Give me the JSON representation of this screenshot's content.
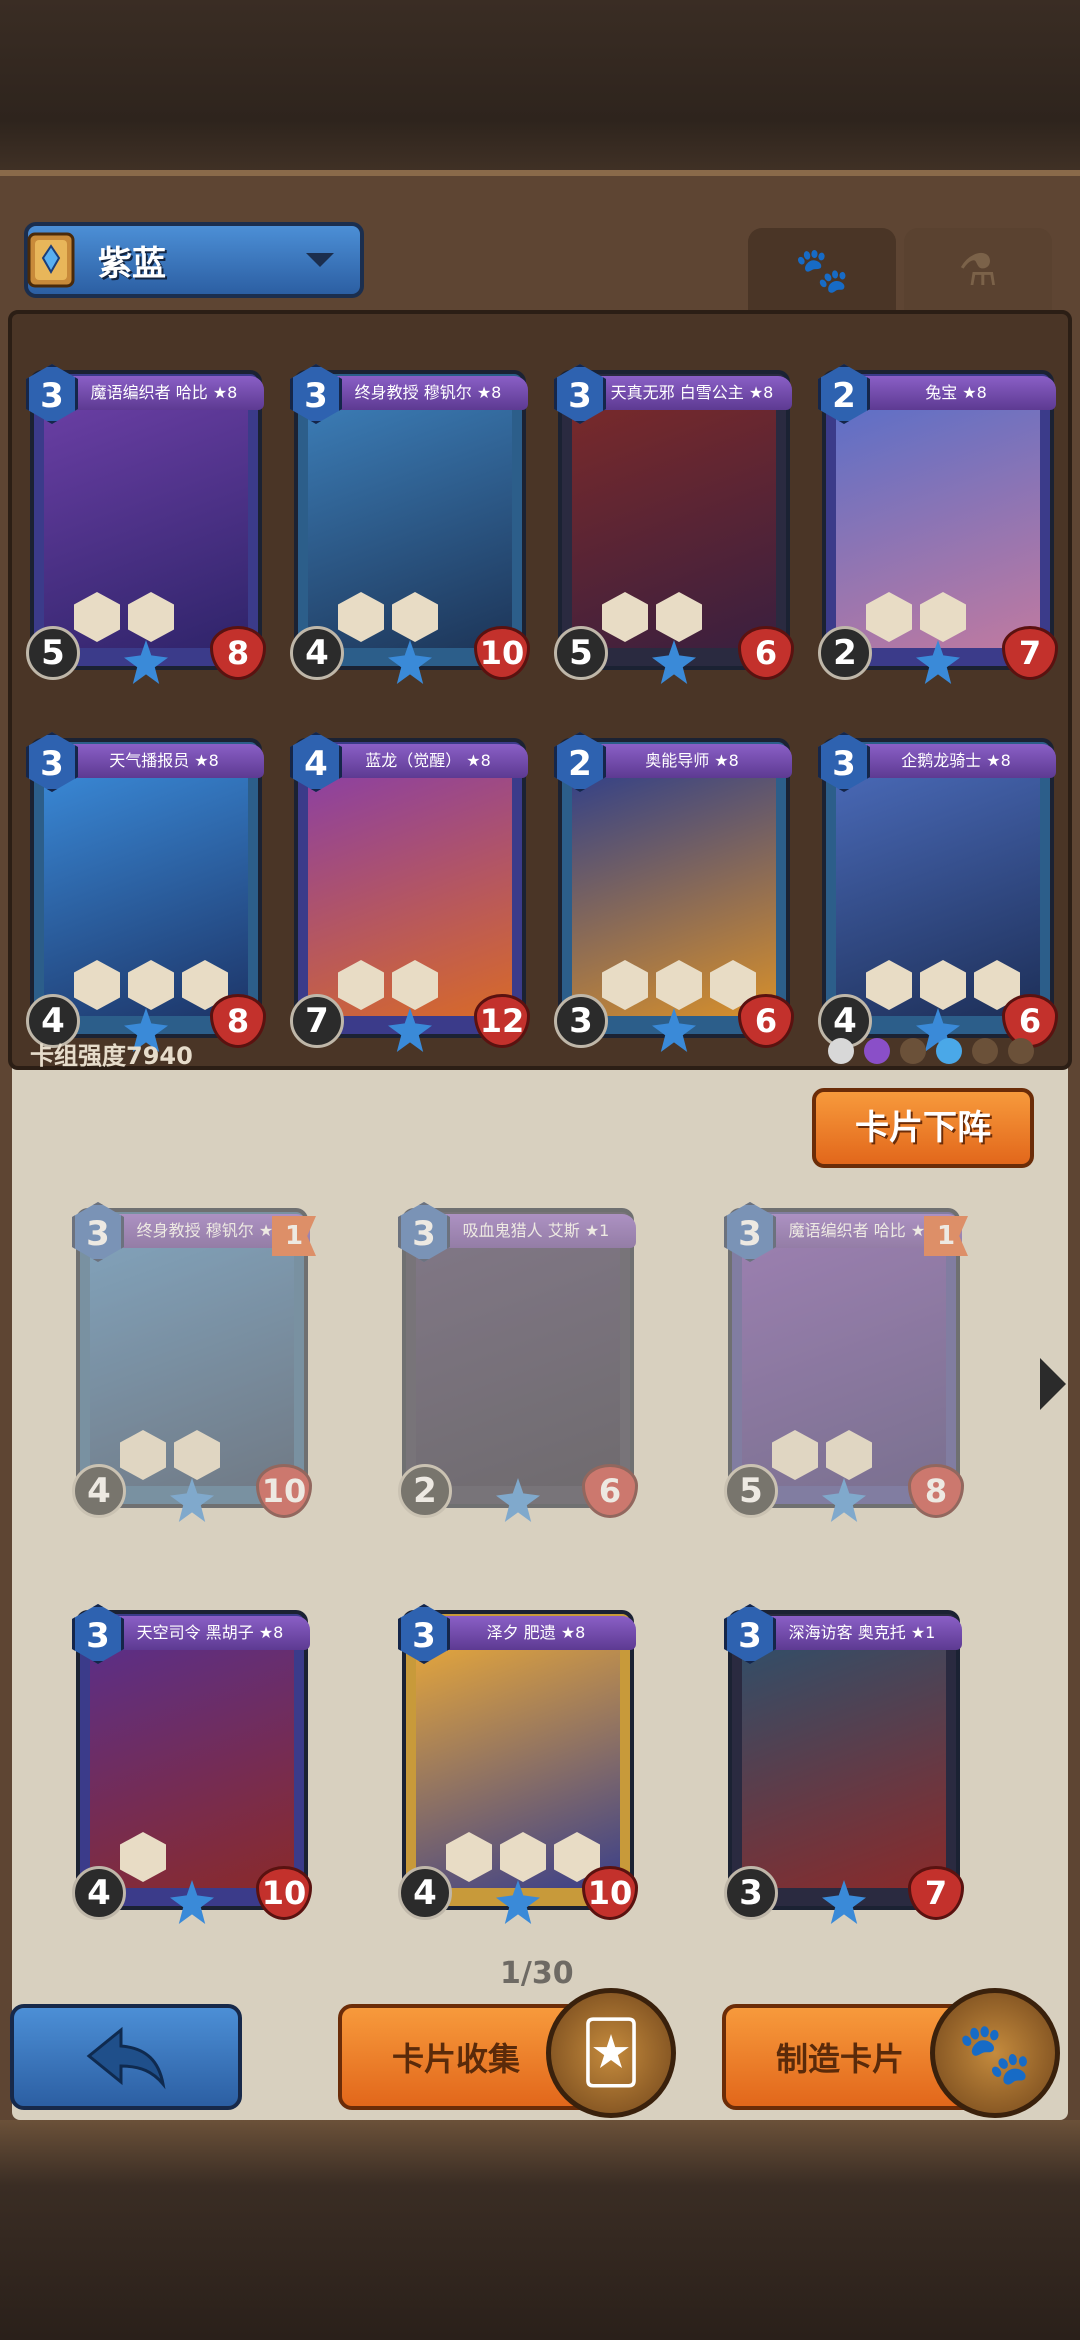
{
  "deck": {
    "name": "紫蓝",
    "strength_label": "卡组强度7940"
  },
  "tabs": {
    "pet_icon": "paw-icon",
    "potion_icon": "potion-icon"
  },
  "deck_cards": [
    {
      "title": "魔语编织者 哈比 ★8",
      "cost": "3",
      "attack": "5",
      "health": "8"
    },
    {
      "title": "终身教授 穆钒尔 ★8",
      "cost": "3",
      "attack": "4",
      "health": "10"
    },
    {
      "title": "天真无邪 白雪公主 ★8",
      "cost": "3",
      "attack": "5",
      "health": "6"
    },
    {
      "title": "兔宝 ★8",
      "cost": "2",
      "attack": "2",
      "health": "7"
    },
    {
      "title": "天气播报员 ★8",
      "cost": "3",
      "attack": "4",
      "health": "8"
    },
    {
      "title": "蓝龙（觉醒） ★8",
      "cost": "4",
      "attack": "7",
      "health": "12"
    },
    {
      "title": "奥能导师 ★8",
      "cost": "2",
      "attack": "3",
      "health": "6"
    },
    {
      "title": "企鹅龙骑士 ★8",
      "cost": "3",
      "attack": "4",
      "health": "6"
    }
  ],
  "collection_cards": [
    {
      "title": "终身教授 穆钒尔 ★8",
      "cost": "3",
      "attack": "4",
      "health": "10",
      "level": "1"
    },
    {
      "title": "吸血鬼猎人 艾斯 ★1",
      "cost": "3",
      "attack": "2",
      "health": "6",
      "level": ""
    },
    {
      "title": "魔语编织者 哈比 ★8",
      "cost": "3",
      "attack": "5",
      "health": "8",
      "level": "1"
    },
    {
      "title": "天空司令 黑胡子 ★8",
      "cost": "3",
      "attack": "4",
      "health": "10",
      "level": ""
    },
    {
      "title": "泽夕 肥遗 ★8",
      "cost": "3",
      "attack": "4",
      "health": "10",
      "level": ""
    },
    {
      "title": "深海访客 奥克托 ★1",
      "cost": "3",
      "attack": "3",
      "health": "7",
      "level": ""
    }
  ],
  "buttons": {
    "remove_label": "卡片下阵",
    "collect_label": "卡片收集",
    "craft_label": "制造卡片"
  },
  "pagination": "1/30",
  "colors": {
    "accent_blue": "#2e62b0",
    "accent_orange": "#e2671b",
    "panel_bg": "#4a3526"
  }
}
